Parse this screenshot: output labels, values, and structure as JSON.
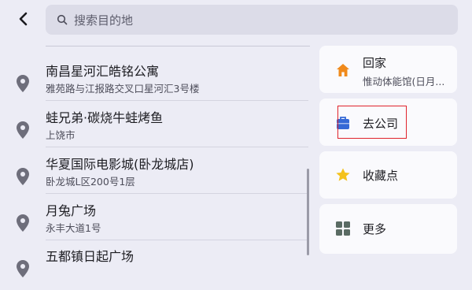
{
  "search": {
    "placeholder": "搜索目的地"
  },
  "results": [
    {
      "title": "南昌星河汇皓铭公寓",
      "subtitle": "雅苑路与江报路交叉口星河汇3号楼"
    },
    {
      "title": "蛙兄弟·碳烧牛蛙烤鱼",
      "subtitle": "上饶市"
    },
    {
      "title": "华夏国际电影城(卧龙城店)",
      "subtitle": "卧龙城L区200号1层"
    },
    {
      "title": "月兔广场",
      "subtitle": "永丰大道1号"
    },
    {
      "title": "五都镇日起广场",
      "subtitle": ""
    }
  ],
  "shortcuts": {
    "home": {
      "label": "回家",
      "subtitle": "惟动体能馆(日月..."
    },
    "company": {
      "label": "去公司"
    },
    "favorites": {
      "label": "收藏点"
    },
    "more": {
      "label": "更多"
    }
  },
  "colors": {
    "home_icon": "#f08a1c",
    "company_icon": "#3569d6",
    "star_icon": "#f4c21c",
    "more_icon": "#5a6b63"
  }
}
